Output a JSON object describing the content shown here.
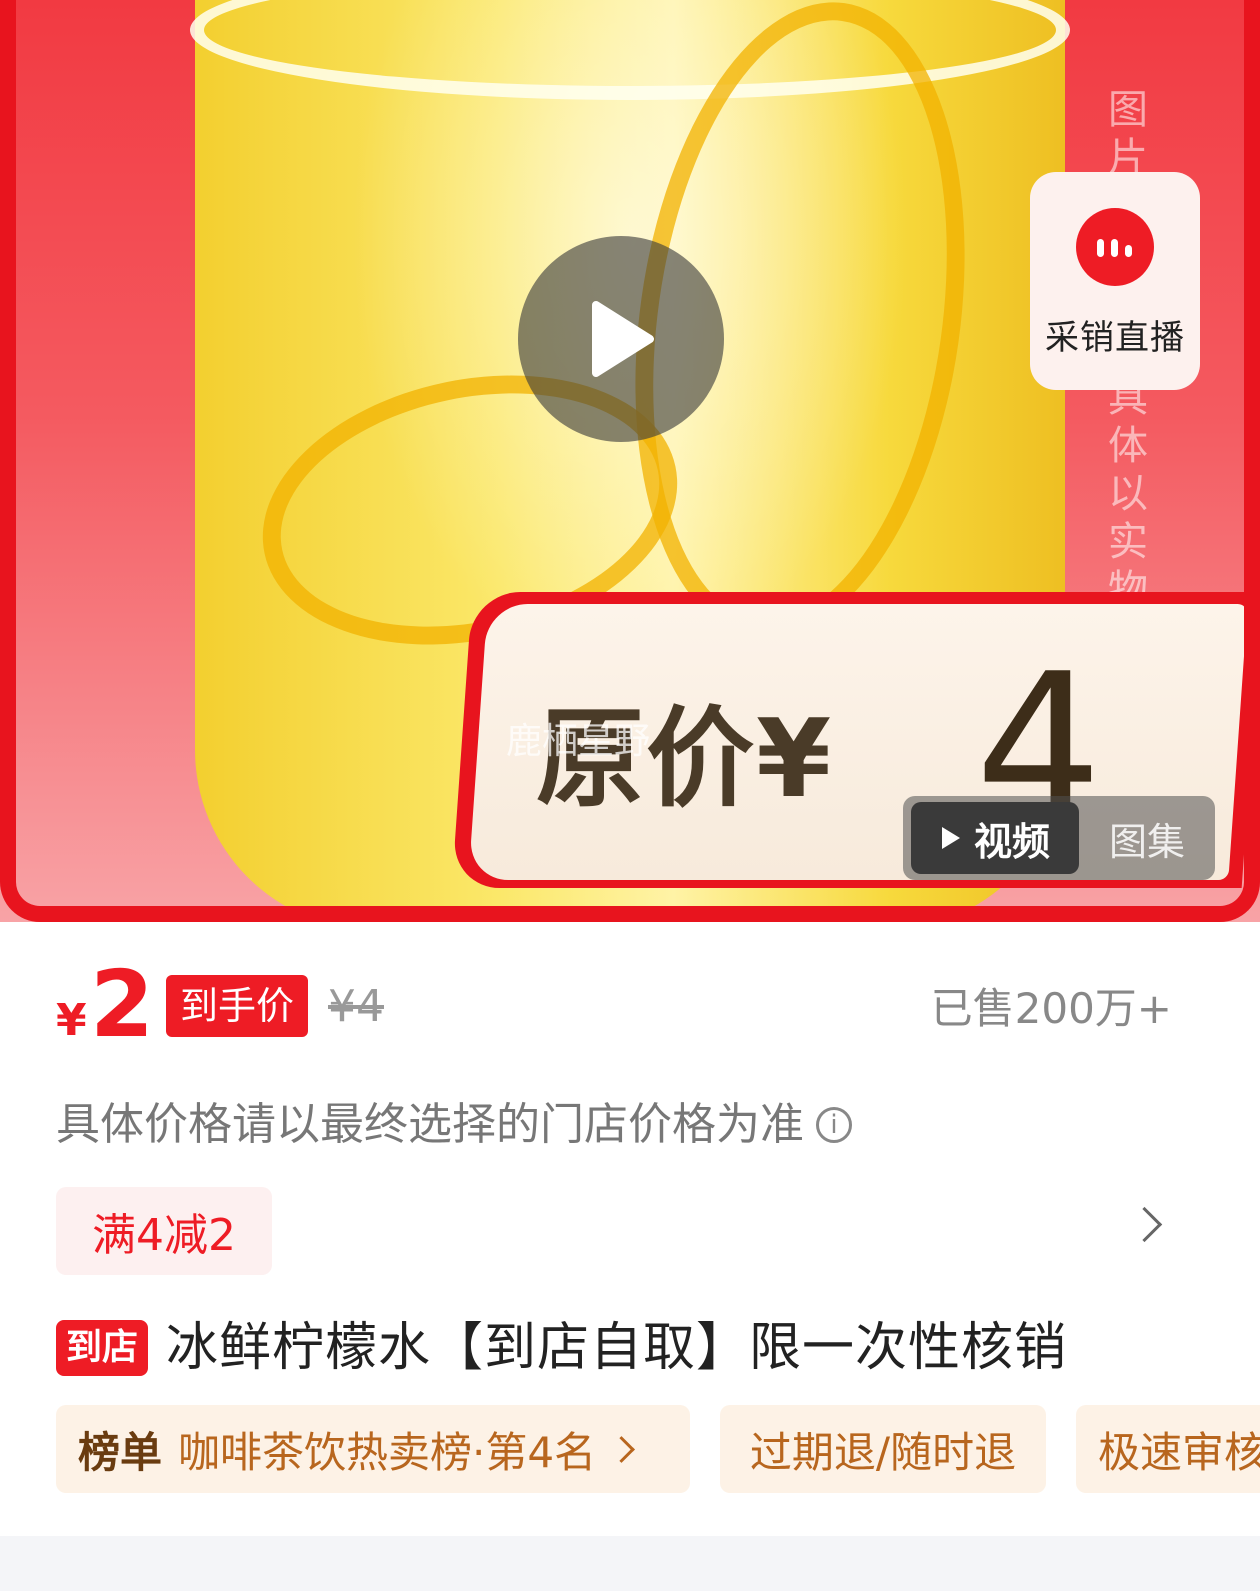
{
  "hero": {
    "side_text": "图片仅供参考具体以实物",
    "live_label": "采销直播",
    "original_price_label": "原价¥",
    "original_price_value": "4",
    "watermark": "鹿栖星野",
    "toggle_video_label": "视频",
    "toggle_gallery_label": "图集"
  },
  "price": {
    "currency": "¥",
    "current": "2",
    "tag": "到手价",
    "original": "¥4",
    "sold": "已售200万+"
  },
  "note": "具体价格请以最终选择的门店价格为准",
  "promo": "满4减2",
  "product": {
    "badge": "到店",
    "title": "冰鲜柠檬水【到店自取】限一次性核销"
  },
  "chips": {
    "rank_key": "榜单",
    "rank_value": "咖啡茶饮热卖榜·第4名",
    "refund": "过期退/随时退",
    "fast": "极速审核"
  },
  "colors": {
    "accent": "#ee1c25",
    "chip_bg": "#fdf2e6",
    "chip_text": "#b8661e"
  }
}
